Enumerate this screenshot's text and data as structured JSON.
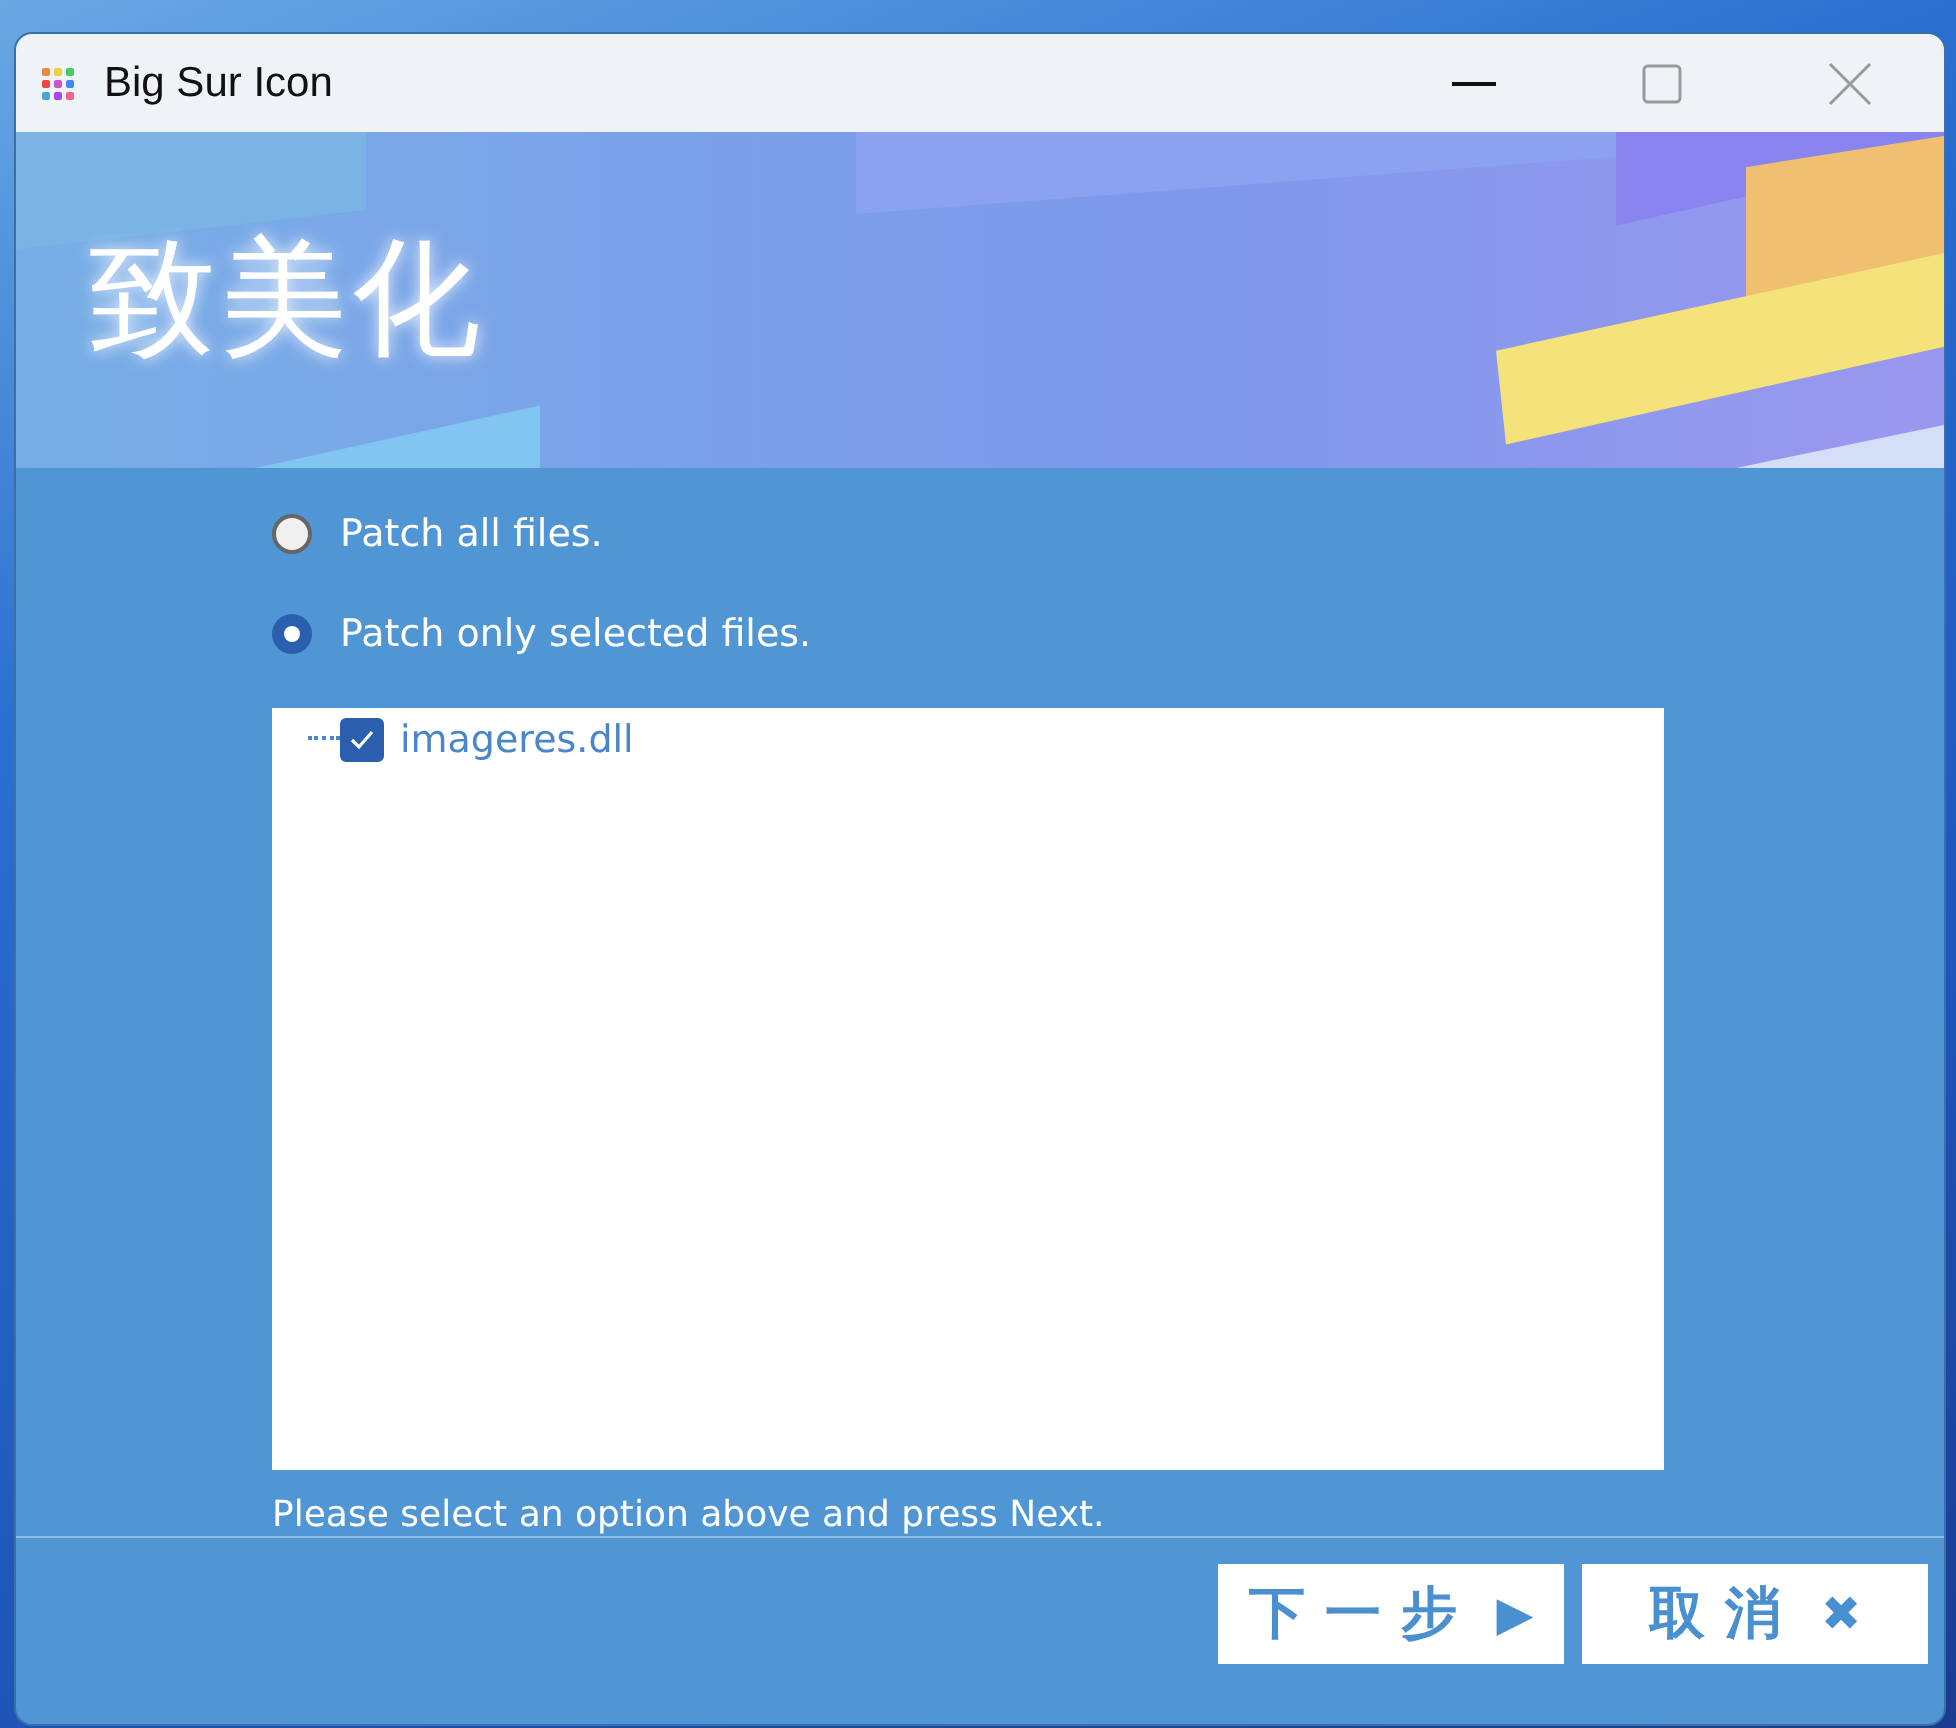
{
  "window": {
    "title": "Big Sur Icon"
  },
  "banner": {
    "logo": "致美化"
  },
  "options": [
    {
      "label": "Patch all files.",
      "selected": false
    },
    {
      "label": "Patch only selected files.",
      "selected": true
    }
  ],
  "file_tree": [
    {
      "label": "imageres.dll",
      "checked": true
    }
  ],
  "status": "Please select an option above and press Next.",
  "buttons": [
    {
      "label": "下一步",
      "symbol": "▶"
    },
    {
      "label": "取消",
      "symbol": "✖"
    }
  ]
}
